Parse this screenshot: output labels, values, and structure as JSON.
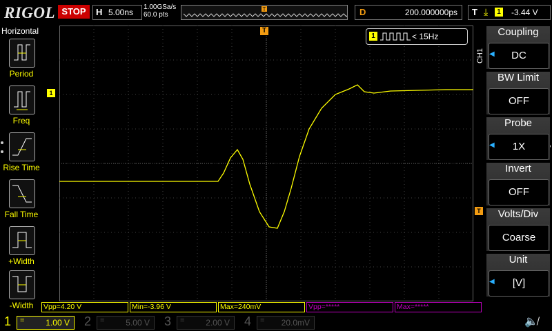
{
  "top": {
    "logo": "RIGOL",
    "run_state": "STOP",
    "horizontal_prefix": "H",
    "timebase": "5.00ns",
    "sample_rate": "1.00GSa/s",
    "points": "60.0 pts",
    "trigger_marker": "T",
    "delay_prefix": "D",
    "delay": "200.000000ps",
    "trigger_prefix": "T",
    "trigger_edge": "⤓",
    "trigger_channel": "1",
    "trigger_level": "-3.44 V"
  },
  "left_menu": {
    "title": "Horizontal",
    "items": [
      {
        "label": "Period",
        "icon": "period-icon"
      },
      {
        "label": "Freq",
        "icon": "freq-icon"
      },
      {
        "label": "Rise Time",
        "icon": "rise-time-icon"
      },
      {
        "label": "Fall Time",
        "icon": "fall-time-icon"
      },
      {
        "label": "+Width",
        "icon": "pos-width-icon"
      },
      {
        "label": "-Width",
        "icon": "neg-width-icon"
      }
    ]
  },
  "screen": {
    "ch1_marker": "1",
    "trigger_top_marker": "T",
    "trigger_level_marker": "T",
    "freq_channel": "1",
    "freq_value": "< 15Hz",
    "channel_vertical_label": "CH1"
  },
  "right_menu": {
    "items": [
      {
        "title": "Coupling",
        "value": "DC",
        "arrow": true
      },
      {
        "title": "BW Limit",
        "value": "OFF",
        "arrow": false
      },
      {
        "title": "Probe",
        "value": "1X",
        "arrow": true
      },
      {
        "title": "Invert",
        "value": "OFF",
        "arrow": false
      },
      {
        "title": "Volts/Div",
        "value": "Coarse",
        "arrow": false
      },
      {
        "title": "Unit",
        "value": "[V]",
        "arrow": true
      }
    ]
  },
  "measurements": [
    {
      "text": "Vpp=4.20 V",
      "color": "#ffff00"
    },
    {
      "text": "Min=-3.96 V",
      "color": "#ffff00"
    },
    {
      "text": "Max=240mV",
      "color": "#ffff00"
    },
    {
      "text": "Vpp=*****",
      "color": "#c000c0"
    },
    {
      "text": "Max=*****",
      "color": "#c000c0"
    }
  ],
  "channels": [
    {
      "num": "1",
      "coupling": "=",
      "scale": "1.00 V",
      "color": "#ffff00",
      "active": true
    },
    {
      "num": "2",
      "coupling": "=",
      "scale": "5.00 V",
      "color": "#00c0c0",
      "active": false
    },
    {
      "num": "3",
      "coupling": "=",
      "scale": "2.00 V",
      "color": "#c000c0",
      "active": false
    },
    {
      "num": "4",
      "coupling": "=",
      "scale": "20.0mV",
      "color": "#2080ff",
      "active": false
    }
  ],
  "colors": {
    "ch1": "#ffff00",
    "trigger": "#f39c12",
    "grid": "#555555"
  }
}
